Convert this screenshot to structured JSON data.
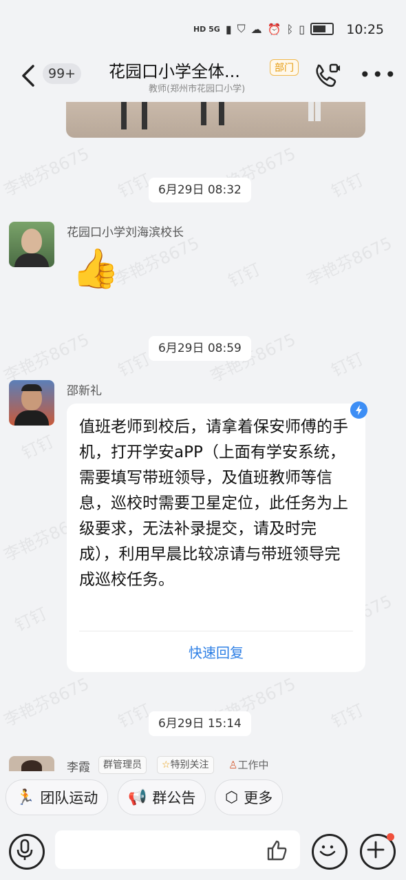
{
  "status_bar": {
    "time": "10:25",
    "left_icons": "HD 5G"
  },
  "header": {
    "back_count": "99+",
    "title": "花园口小学全体...",
    "dept_tag": "部门",
    "subtitle": "教师(郑州市花园口小学)"
  },
  "watermark": "李艳芬8675",
  "watermark_brand": "钉钉",
  "messages": [
    {
      "timestamp": "6月29日 08:32",
      "sender": "花园口小学刘海滨校长",
      "content_emoji": "👍"
    },
    {
      "timestamp": "6月29日 08:59",
      "sender": "邵新礼",
      "text": "值班老师到校后，请拿着保安师傅的手机，打开学安aPP（上面有学安系统，需要填写带班领导，及值班教师等信息，巡校时需要卫星定位，此任务为上级要求，无法补录提交，请及时完成），利用早晨比较凉请与带班领导完成巡校任务。",
      "quick_reply": "快速回复"
    },
    {
      "timestamp": "6月29日 15:14",
      "sender": "李霞",
      "tags": [
        "群管理员",
        "特别关注",
        "工作中"
      ]
    }
  ],
  "quick_actions": [
    "团队运动",
    "群公告",
    "更多"
  ],
  "colors": {
    "accent": "#2d7fe5",
    "dept_tag": "#e59a0c"
  }
}
